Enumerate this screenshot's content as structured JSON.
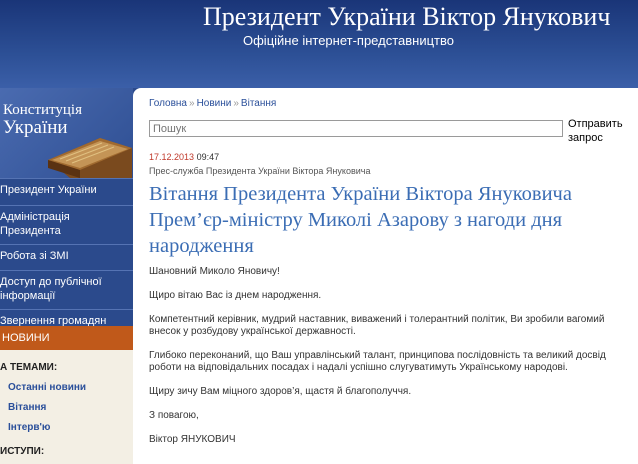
{
  "header": {
    "title": "Президент України Віктор Янукович",
    "subtitle": "Офіційне інтернет-представництво"
  },
  "sidebar": {
    "constitution_line1": "Конституція",
    "constitution_line2": "України",
    "nav": [
      {
        "label": "Президент України"
      },
      {
        "label": "Адміністрація Президента"
      },
      {
        "label": "Робота зі ЗМІ"
      },
      {
        "label": "Доступ до публічної інформації"
      },
      {
        "label": "Звернення громадян"
      }
    ],
    "news_label": "НОВИНИ",
    "topics_heading": "А ТЕМАМИ:",
    "topics": [
      "Останні новини",
      "Вітання",
      "Інтерв'ю"
    ],
    "speeches_heading": "ИСТУПИ:"
  },
  "breadcrumb": [
    "Головна",
    "Новини",
    "Вітання"
  ],
  "search": {
    "placeholder": "Пошук",
    "button_label": "Отправить запрос"
  },
  "article": {
    "date": "17.12.2013",
    "time": "09:47",
    "source": "Прес-служба Президента України Віктора Януковича",
    "title": "Вітання Президента України Віктора Януковича Прем’єр-міністру Миколі Азарову з нагоди дня народження",
    "paragraphs": [
      "Шановний Миколо Яновичу!",
      "Щиро вітаю Вас із днем народження.",
      "Компетентний керівник, мудрий наставник, виважений і толерантний політик, Ви зробили вагомий внесок у розбудову української державності.",
      "Глибоко переконаний, що Ваш управлінський талант, принципова послідовність та великий досвід роботи на відповідальних посадах і надалі успішно слугуватимуть Українському народові.",
      "Щиру зичу Вам міцного здоров’я, щастя й благополуччя.",
      "З повагою,",
      "Віктор ЯНУКОВИЧ"
    ]
  }
}
